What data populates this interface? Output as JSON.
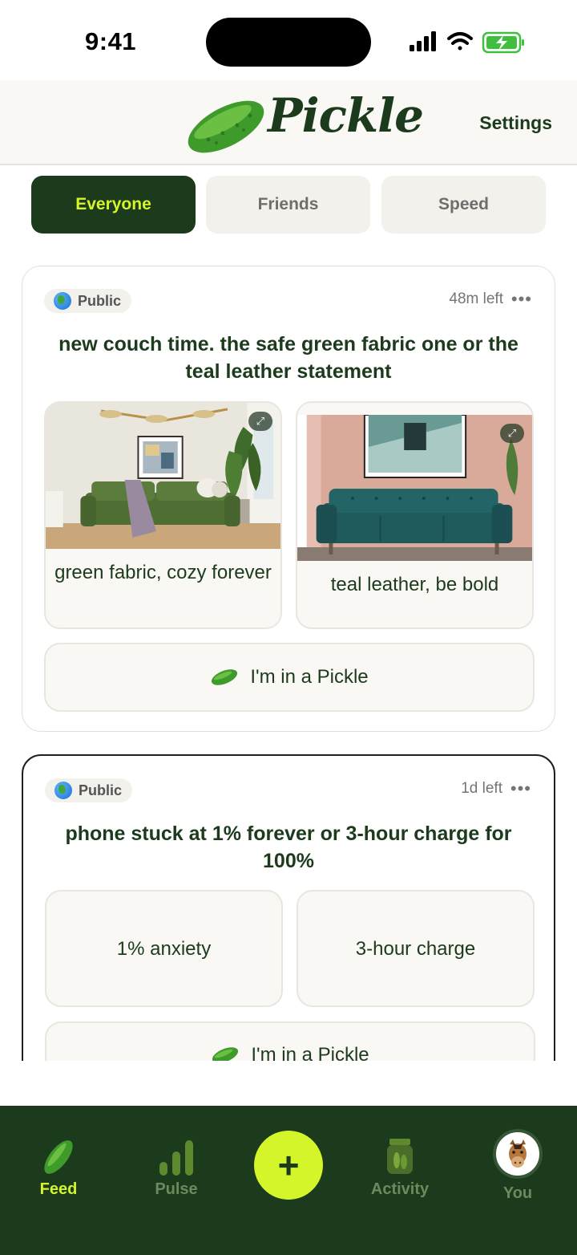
{
  "status_bar": {
    "time": "9:41"
  },
  "header": {
    "logo_text": "Pickle",
    "settings_label": "Settings"
  },
  "tabs": [
    {
      "label": "Everyone",
      "active": true
    },
    {
      "label": "Friends",
      "active": false
    },
    {
      "label": "Speed",
      "active": false
    }
  ],
  "posts": [
    {
      "visibility": "Public",
      "time_left": "48m left",
      "question": "new couch time. the safe green fabric one or the teal leather statement",
      "options": [
        {
          "label": "green fabric, cozy forever",
          "image": "green-sofa-photo"
        },
        {
          "label": "teal leather, be bold",
          "image": "teal-sofa-photo"
        }
      ],
      "pickle_label": "I'm in a Pickle"
    },
    {
      "visibility": "Public",
      "time_left": "1d left",
      "question": "phone stuck at 1% forever or 3-hour charge for 100%",
      "options": [
        {
          "label": "1% anxiety"
        },
        {
          "label": "3-hour charge"
        }
      ],
      "pickle_label": "I'm in a Pickle"
    }
  ],
  "bottom_nav": {
    "items": [
      {
        "label": "Feed",
        "icon": "pickle-icon",
        "active": true
      },
      {
        "label": "Pulse",
        "icon": "bar-chart-icon",
        "active": false
      },
      {
        "label": "Activity",
        "icon": "pickle-jar-icon",
        "active": false
      },
      {
        "label": "You",
        "icon": "horse-avatar",
        "active": false
      }
    ],
    "create_label": "+"
  },
  "colors": {
    "brand_dark": "#1c3a1c",
    "accent_lime": "#d4f52a",
    "surface": "#f9f8f4",
    "inactive_nav": "#6d8a5c"
  }
}
